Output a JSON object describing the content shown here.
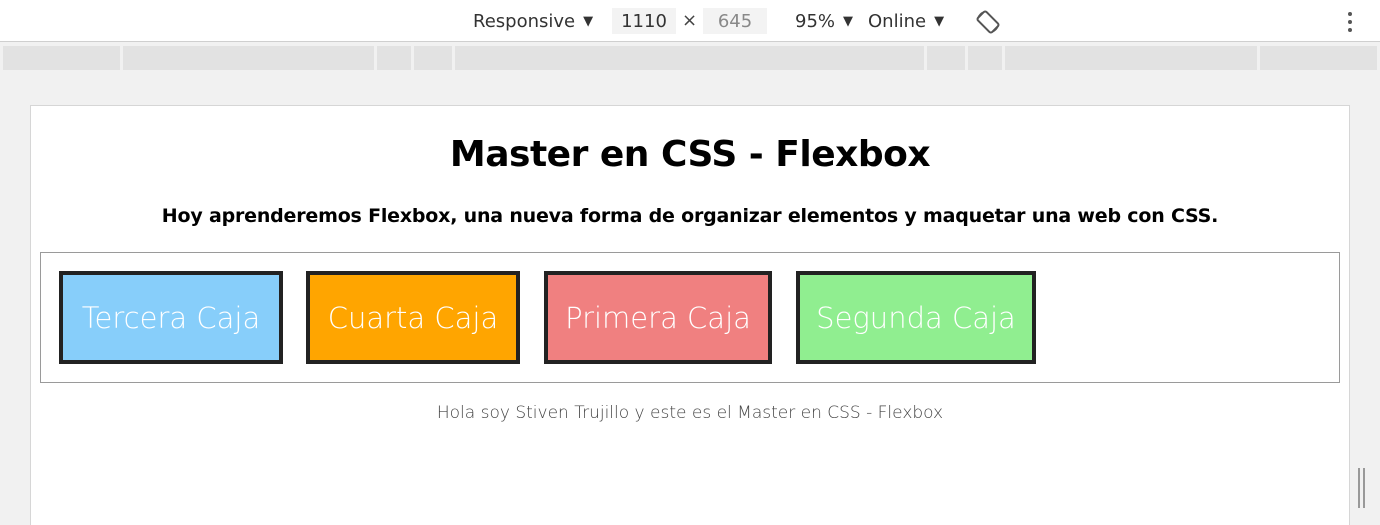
{
  "devtools": {
    "device_label": "Responsive",
    "width": "1110",
    "height": "645",
    "times": "×",
    "zoom_label": "95%",
    "throttle_label": "Online"
  },
  "page": {
    "title": "Master en CSS - Flexbox",
    "subtitle": "Hoy aprenderemos Flexbox, una nueva forma de organizar elementos y maquetar una web con CSS.",
    "boxes": [
      {
        "label": "Tercera Caja",
        "color": "#87cefa"
      },
      {
        "label": "Cuarta Caja",
        "color": "#ffa500"
      },
      {
        "label": "Primera Caja",
        "color": "#f08080"
      },
      {
        "label": "Segunda Caja",
        "color": "#90ee90"
      }
    ],
    "footer": "Hola soy Stiven Trujillo y este es el Master en CSS - Flexbox"
  }
}
